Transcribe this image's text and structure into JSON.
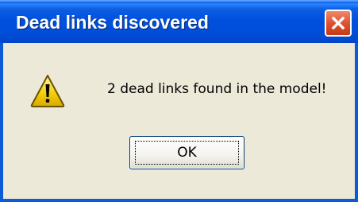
{
  "window": {
    "title": "Dead links discovered",
    "close_icon": "close-icon"
  },
  "dialog": {
    "icon": "warning-icon",
    "message": "2 dead links found in the model!",
    "ok_label": "OK"
  },
  "colors": {
    "titlebar": "#0050df",
    "frame": "#0a5bd8",
    "body": "#ece9d8",
    "close_button": "#e0522f",
    "warning_fill": "#f5d20a"
  }
}
